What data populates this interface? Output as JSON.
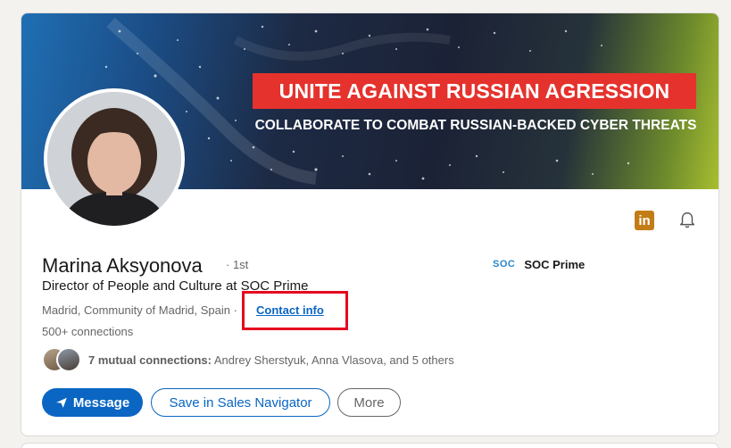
{
  "banner": {
    "title": "UNITE AGAINST RUSSIAN AGRESSION",
    "subtitle": "COLLABORATE TO COMBAT RUSSIAN-BACKED CYBER THREATS"
  },
  "profile": {
    "name": "Marina Aksyonova",
    "degree": "· 1st",
    "headline": "Director of People and Culture at SOC Prime",
    "location": "Madrid, Community of Madrid, Spain ·",
    "contact_info": "Contact info",
    "connections": "500+ connections",
    "mutual_count": "7 mutual connections:",
    "mutual_names": "Andrey Sherstyuk, Anna Vlasova, and 5 others"
  },
  "company": {
    "logo_text": "SOC",
    "name": "SOC Prime"
  },
  "actions": {
    "message": "Message",
    "sales_navigator": "Save in Sales Navigator",
    "more": "More"
  },
  "icons": {
    "linkedin": "linkedin-icon",
    "bell": "bell-icon",
    "send": "send-icon"
  },
  "colors": {
    "primary": "#0a66c2",
    "banner_red": "#e5322d",
    "highlight_box": "#e5091f",
    "linkedin_badge": "#c37d16"
  }
}
